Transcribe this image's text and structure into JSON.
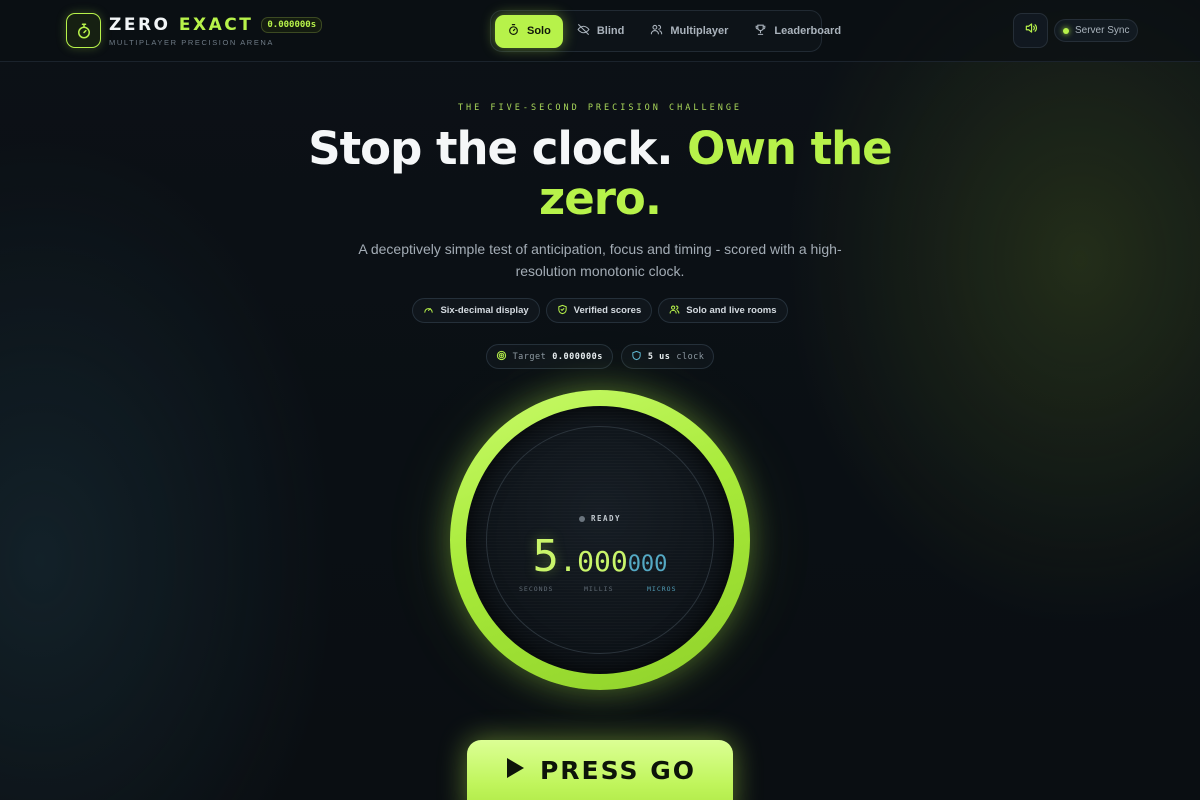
{
  "brand": {
    "title_main": "ZERO",
    "title_accent": "EXACT",
    "chip": "0.000000s",
    "subtitle": "MULTIPLAYER PRECISION ARENA",
    "icon": "stopwatch-icon"
  },
  "nav": {
    "tabs": [
      {
        "label": "Solo",
        "icon": "stopwatch-icon",
        "active": true
      },
      {
        "label": "Blind",
        "icon": "eye-off-icon",
        "active": false
      },
      {
        "label": "Multiplayer",
        "icon": "users-icon",
        "active": false
      },
      {
        "label": "Leaderboard",
        "icon": "trophy-icon",
        "active": false
      }
    ],
    "sound_icon": "speaker-icon",
    "sync_label": "Server Sync"
  },
  "hero": {
    "eyebrow": "THE FIVE-SECOND PRECISION CHALLENGE",
    "headline_white": "Stop the clock.",
    "headline_accent": "Own the zero.",
    "subtext": "A deceptively simple test of anticipation, focus and timing - scored with a high-resolution monotonic clock."
  },
  "features": [
    {
      "label": "Six-decimal display",
      "icon": "gauge-icon"
    },
    {
      "label": "Verified scores",
      "icon": "shield-check-icon"
    },
    {
      "label": "Solo and live rooms",
      "icon": "users-icon"
    }
  ],
  "meta": {
    "target_label": "Target",
    "target_value": "0.000000s",
    "clock_value": "5 us",
    "clock_label": "clock"
  },
  "timer": {
    "status": "READY",
    "seconds": "5",
    "separator": ".",
    "millis": "000",
    "micros": "000",
    "unit_seconds": "SECONDS",
    "unit_millis": "MILLIS",
    "unit_micros": "MICROS"
  },
  "go_button": {
    "label": "PRESS GO",
    "icon": "play-icon"
  },
  "colors": {
    "accent": "#b7f24a",
    "micro": "#54a9c4",
    "background": "#0b1015"
  }
}
